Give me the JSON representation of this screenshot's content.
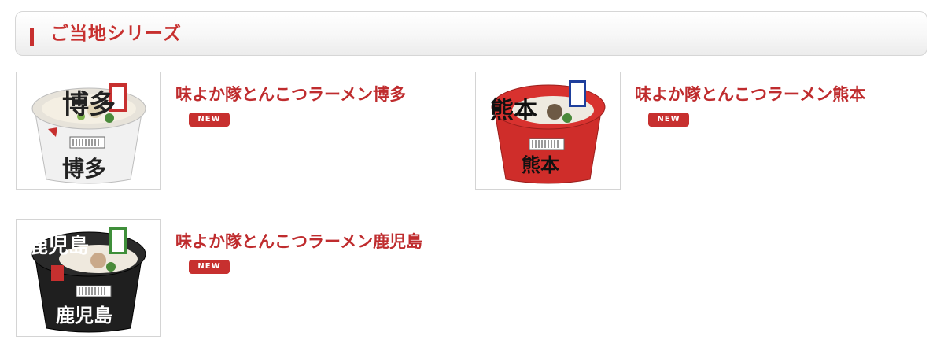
{
  "section": {
    "title": "ご当地シリーズ"
  },
  "products": [
    {
      "name": "味よか隊とんこつラーメン博多",
      "badge": "NEW",
      "cup_label": "博多",
      "theme": "white"
    },
    {
      "name": "味よか隊とんこつラーメン熊本",
      "badge": "NEW",
      "cup_label": "熊本",
      "theme": "red"
    },
    {
      "name": "味よか隊とんこつラーメン鹿児島",
      "badge": "NEW",
      "cup_label": "鹿児島",
      "theme": "black"
    }
  ],
  "colors": {
    "accent": "#c7302f",
    "name_text": "#bf2c2e",
    "border": "#d4d4d4"
  }
}
